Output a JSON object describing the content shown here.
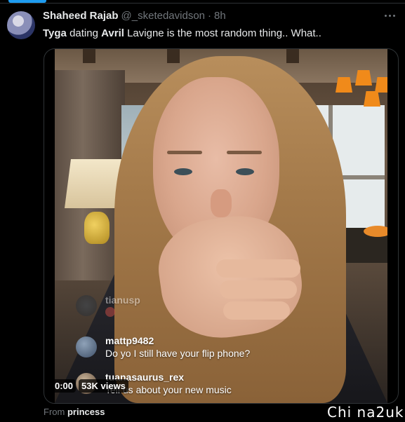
{
  "tweet": {
    "author_name": "Shaheed Rajab",
    "handle": "@_sketedavidson",
    "separator": "·",
    "time": "8h",
    "text_part1": "Tyga",
    "text_part2": " dating ",
    "text_part3": "Avril",
    "text_part4": " Lavigne is the most random thing.. What.."
  },
  "video": {
    "time": "0:00",
    "views": "53K views",
    "comments": [
      {
        "user": "tianusp",
        "text": "",
        "faded": true
      },
      {
        "user": "mattp9482",
        "text": "Do yo I still have your flip phone?"
      },
      {
        "user": "tuanasaurus_rex",
        "text": "Tell us about your new music"
      }
    ]
  },
  "attribution": {
    "prefix": "From ",
    "source": "princess"
  },
  "watermark": "Chi na2uk",
  "icons": {
    "more": "more-horizontal-icon"
  },
  "colors": {
    "background": "#000000",
    "text_primary": "#e7e9ea",
    "text_secondary": "#71767b",
    "accent": "#1d9bf0",
    "border": "#2f3336"
  }
}
